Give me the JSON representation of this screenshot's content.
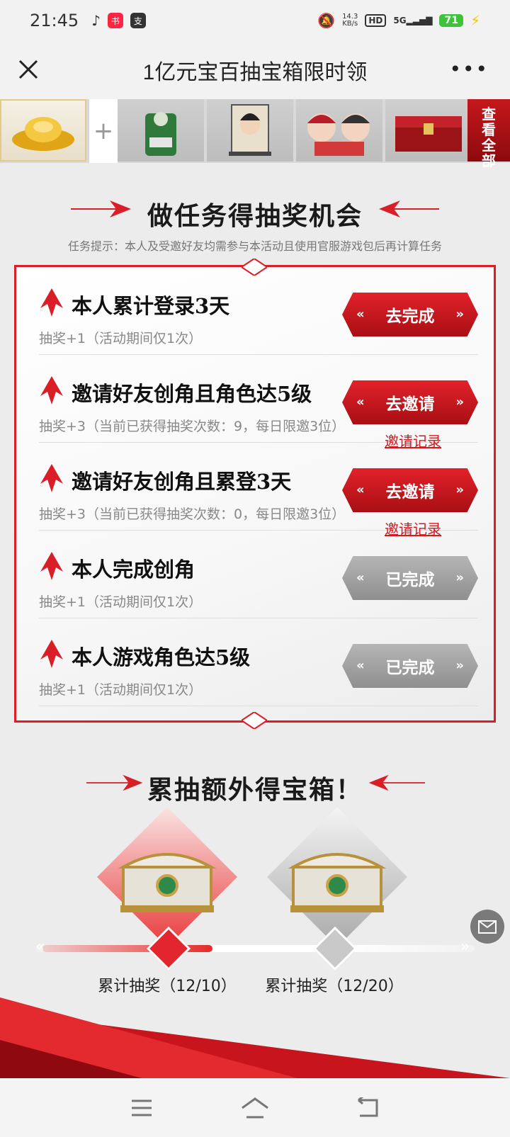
{
  "status_bar": {
    "time": "21:45",
    "net_speed_top": "14.3",
    "net_speed_bottom": "KB/s",
    "hd_label": "HD",
    "network": "5G",
    "battery": "71"
  },
  "header": {
    "title": "1亿元宝百抽宝箱限时领"
  },
  "rewards_strip": {
    "plus": "+",
    "all_button": "查看全部"
  },
  "tasks_section": {
    "title": "做任务得抽奖机会",
    "tip": "任务提示：本人及受邀好友均需参与本活动且使用官服游戏包后再计算任务",
    "tasks": [
      {
        "name": "本人累计登录3天",
        "desc": "抽奖+1（活动期间仅1次）",
        "button": "去完成",
        "link": ""
      },
      {
        "name": "邀请好友创角且角色达5级",
        "desc": "抽奖+3（当前已获得抽奖次数：9，每日限邀3位）",
        "button": "去邀请",
        "link": "邀请记录"
      },
      {
        "name": "邀请好友创角且累登3天",
        "desc": "抽奖+3（当前已获得抽奖次数：0，每日限邀3位）",
        "button": "去邀请",
        "link": "邀请记录"
      },
      {
        "name": "本人完成创角",
        "desc": "抽奖+1（活动期间仅1次）",
        "button": "已完成",
        "link": ""
      },
      {
        "name": "本人游戏角色达5级",
        "desc": "抽奖+1（活动期间仅1次）",
        "button": "已完成",
        "link": ""
      }
    ]
  },
  "chest_section": {
    "title": "累抽额外得宝箱！",
    "progress": 0.4,
    "chests": [
      {
        "label": "累计抽奖（12/10）",
        "achieved": true
      },
      {
        "label": "累计抽奖（12/20）",
        "achieved": false
      }
    ]
  },
  "colors": {
    "accent_red": "#d91e27",
    "done_gray": "#9e9e9e"
  }
}
